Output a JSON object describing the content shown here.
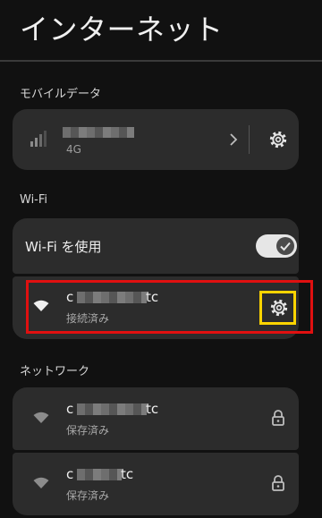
{
  "header": {
    "title": "インターネット"
  },
  "mobile_section": {
    "label": "モバイルデータ",
    "carrier": {
      "sub_label": "4G"
    }
  },
  "wifi_section": {
    "label": "Wi-Fi",
    "use_wifi_label": "Wi-Fi を使用",
    "use_wifi_enabled": true,
    "connected_network": {
      "name_prefix": "c",
      "name_suffix": "tc",
      "status": "接続済み"
    }
  },
  "network_section": {
    "label": "ネットワーク",
    "saved_networks": [
      {
        "name_prefix": "c",
        "name_suffix": "tc",
        "status": "保存済み"
      },
      {
        "name_prefix": "c",
        "name_suffix": "tc",
        "status": "保存済み"
      }
    ]
  },
  "colors": {
    "background": "#111111",
    "card": "#2c2c2c",
    "highlight_red": "#e01010",
    "highlight_yellow": "#ffd400"
  },
  "icons": [
    "signal-icon",
    "chevron-right-icon",
    "gear-icon",
    "wifi-icon",
    "lock-icon",
    "check-icon"
  ]
}
